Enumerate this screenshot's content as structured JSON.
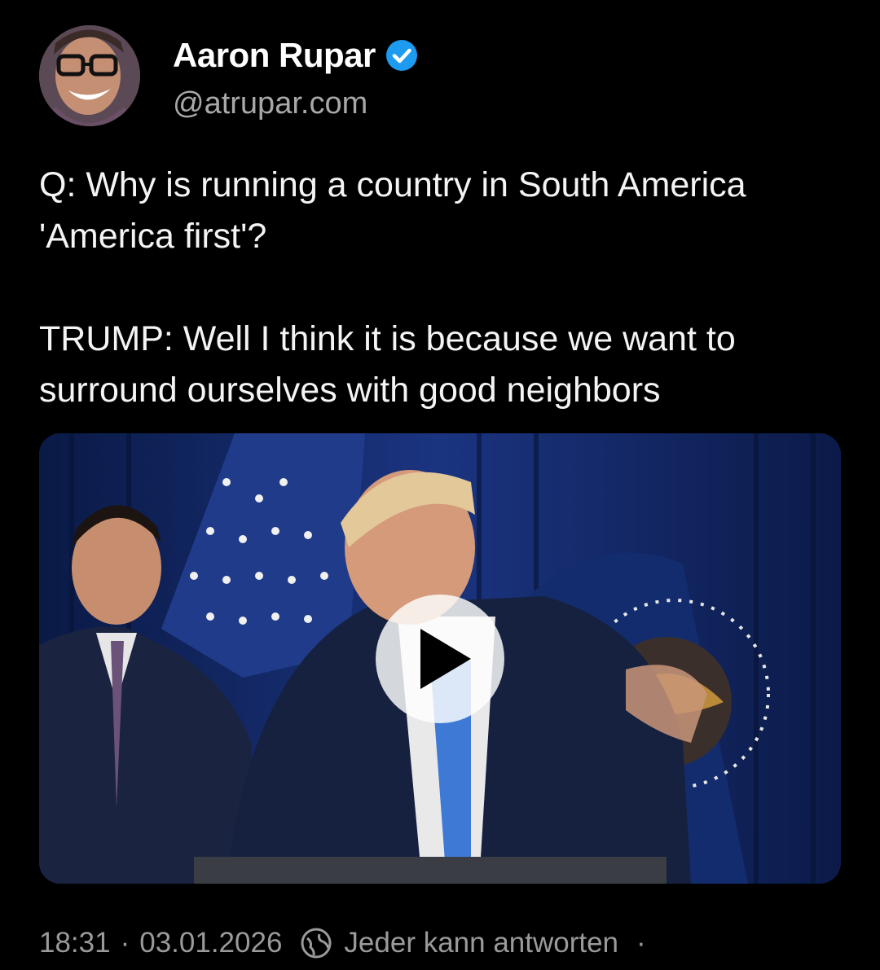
{
  "author": {
    "name": "Aaron Rupar",
    "handle": "@atrupar.com",
    "avatar_icon": "person-with-glasses-avatar",
    "verified_icon": "verified-check-icon",
    "verified_color": "#1d9bf0"
  },
  "post": {
    "text": "Q: Why is running a country in South America 'America first'?\n\nTRUMP: Well I think it is because we want to surround ourselves with good neighbors"
  },
  "media": {
    "type": "video",
    "play_icon": "play-icon"
  },
  "meta": {
    "time": "18:31",
    "separator": "·",
    "date": "03.01.2026",
    "reply_icon": "globe-reply-icon",
    "reply_setting": "Jeder kann antworten",
    "trailing": "·"
  }
}
